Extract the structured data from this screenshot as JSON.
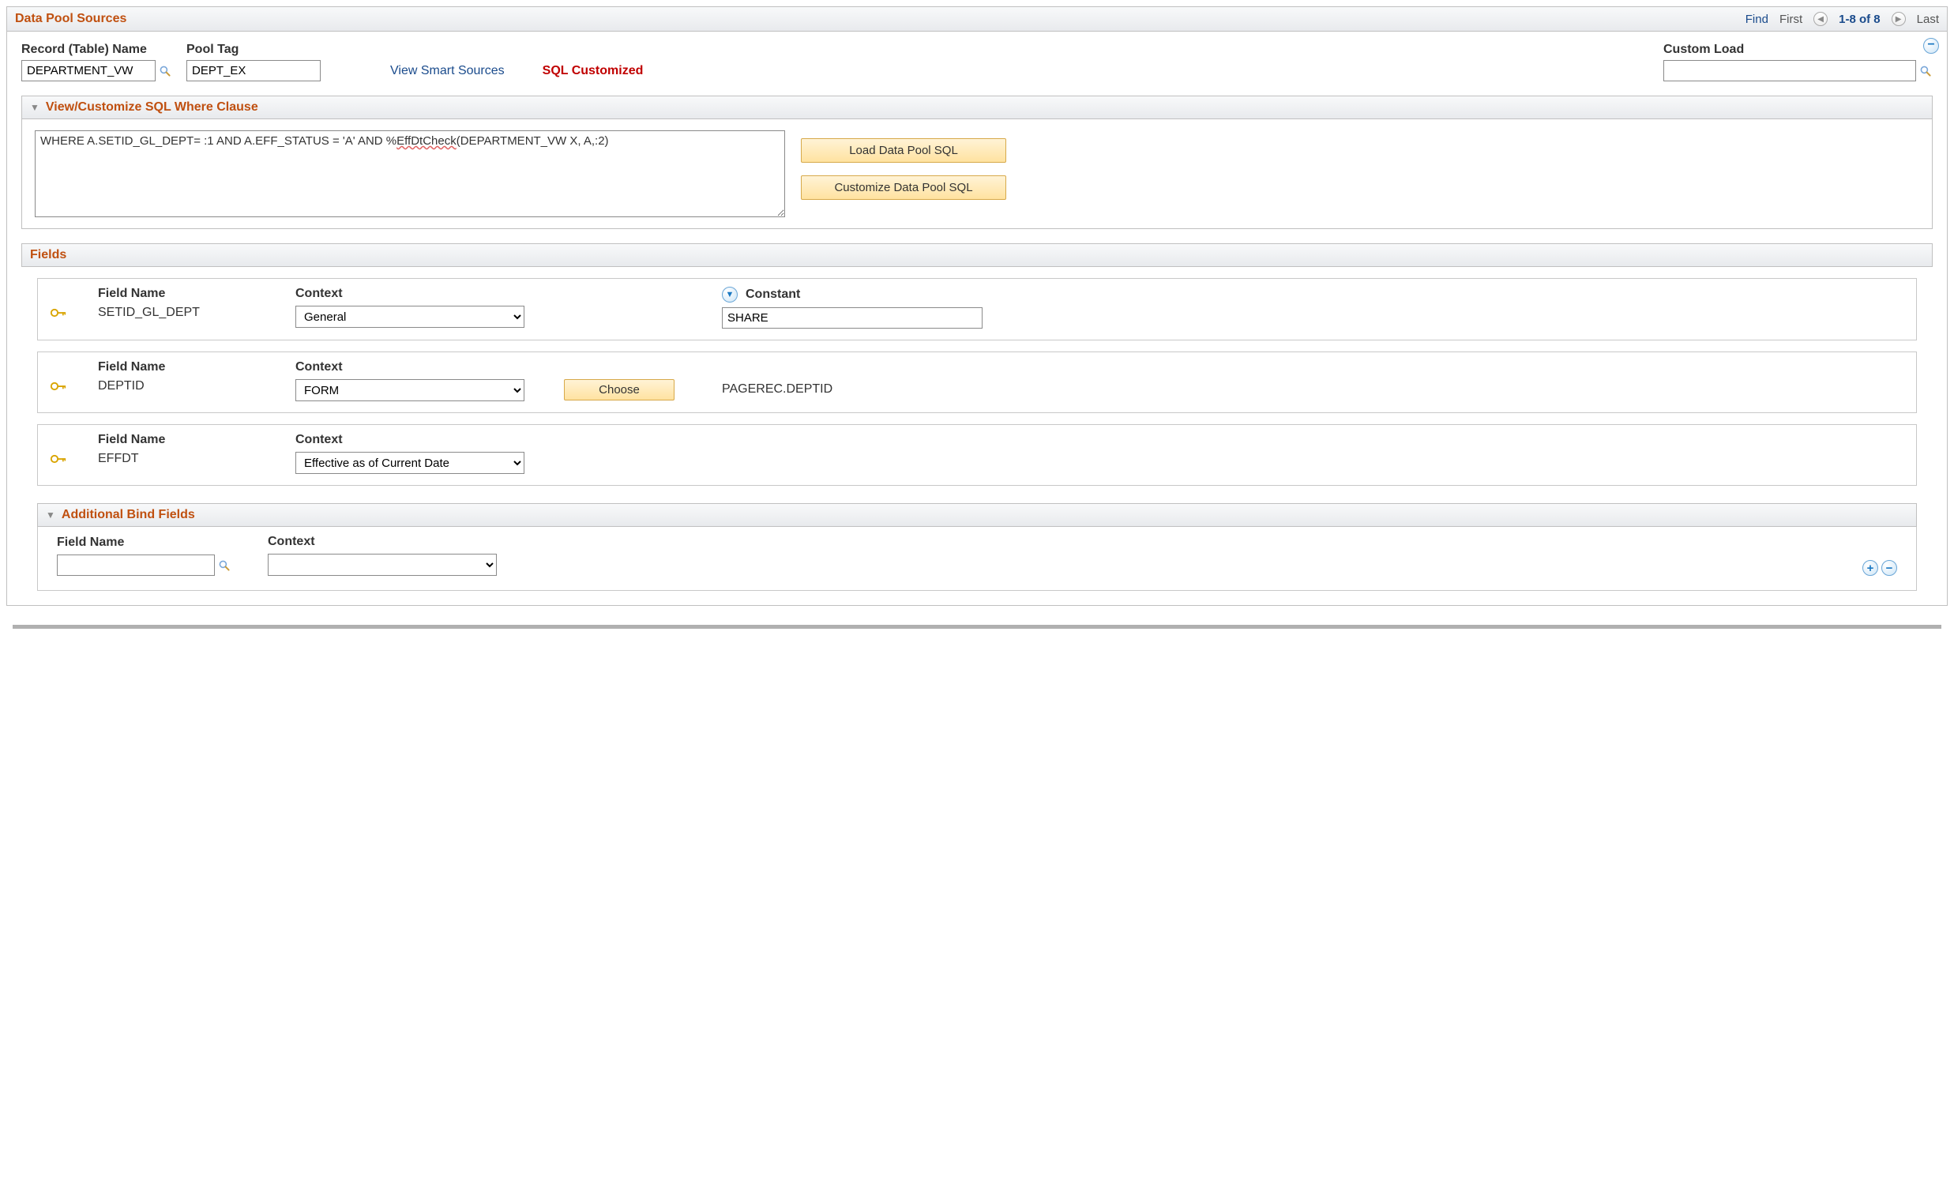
{
  "header": {
    "title": "Data Pool Sources",
    "find": "Find",
    "first": "First",
    "range": "1-8 of 8",
    "last": "Last"
  },
  "topRow": {
    "recordLabel": "Record (Table) Name",
    "recordValue": "DEPARTMENT_VW",
    "poolTagLabel": "Pool Tag",
    "poolTagValue": "DEPT_EX",
    "viewSmartSources": "View Smart Sources",
    "sqlCustomized": "SQL Customized",
    "customLoadLabel": "Custom Load",
    "customLoadValue": ""
  },
  "whereClause": {
    "title": "View/Customize SQL Where Clause",
    "sqlPrefix": "WHERE A.SETID_GL_DEPT= :1 AND A.EFF_STATUS = 'A' AND %",
    "sqlSpell": "EffDtCheck",
    "sqlSuffix": "(DEPARTMENT_VW X, A,:2)",
    "loadBtn": "Load Data Pool SQL",
    "customizeBtn": "Customize Data Pool SQL"
  },
  "fieldsSection": {
    "title": "Fields",
    "labels": {
      "fieldName": "Field Name",
      "context": "Context",
      "constant": "Constant"
    },
    "rows": [
      {
        "fieldName": "SETID_GL_DEPT",
        "context": "General",
        "constant": "SHARE",
        "showConstant": true,
        "showChoose": false,
        "refValue": ""
      },
      {
        "fieldName": "DEPTID",
        "context": "FORM",
        "constant": "",
        "showConstant": false,
        "showChoose": true,
        "chooseLabel": "Choose",
        "refValue": "PAGEREC.DEPTID"
      },
      {
        "fieldName": "EFFDT",
        "context": "Effective as of Current Date",
        "constant": "",
        "showConstant": false,
        "showChoose": false,
        "refValue": ""
      }
    ]
  },
  "bind": {
    "title": "Additional Bind Fields",
    "fieldNameLabel": "Field Name",
    "contextLabel": "Context",
    "fieldNameValue": "",
    "contextValue": ""
  }
}
